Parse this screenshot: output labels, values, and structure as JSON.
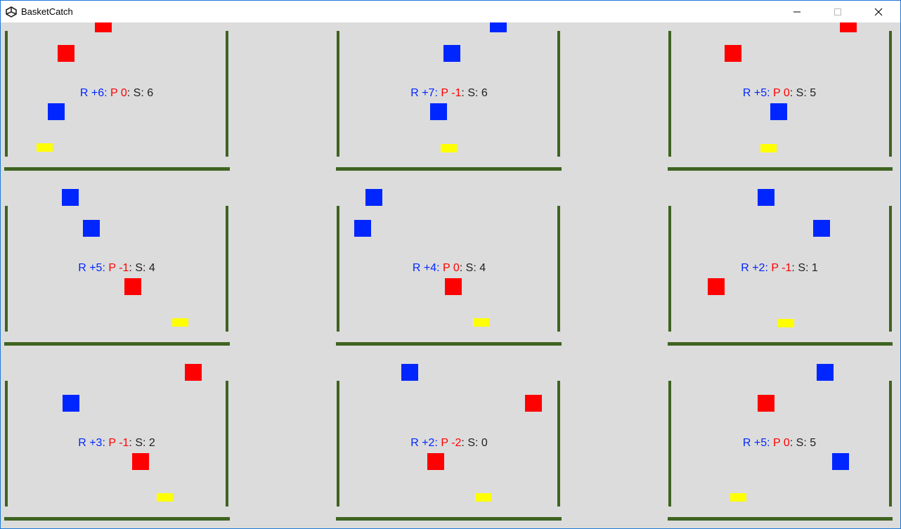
{
  "window": {
    "title": "BasketCatch"
  },
  "icons": {
    "app": "unity-logo-icon",
    "minimize": "minimize-icon",
    "maximize": "maximize-icon",
    "close": "close-icon"
  },
  "colors": {
    "background": "#dcdcdc",
    "wall": "#3f6421",
    "reward_box": "#0026ff",
    "penalty_box": "#ff0000",
    "basket": "#ffff00"
  },
  "arenas": [
    {
      "reward": "R +6",
      "penalty": "P 0",
      "score": "S: 6"
    },
    {
      "reward": "R +7",
      "penalty": "P -1",
      "score": "S: 6"
    },
    {
      "reward": "R +5",
      "penalty": "P 0",
      "score": "S: 5"
    },
    {
      "reward": "R +5",
      "penalty": "P -1",
      "score": "S: 4"
    },
    {
      "reward": "R +4",
      "penalty": "P 0",
      "score": "S: 4"
    },
    {
      "reward": "R +2",
      "penalty": "P -1",
      "score": "S: 1"
    },
    {
      "reward": "R +3",
      "penalty": "P -1",
      "score": "S: 2"
    },
    {
      "reward": "R +2",
      "penalty": "P -2",
      "score": "S: 0"
    },
    {
      "reward": "R +5",
      "penalty": "P 0",
      "score": "S: 5"
    }
  ]
}
